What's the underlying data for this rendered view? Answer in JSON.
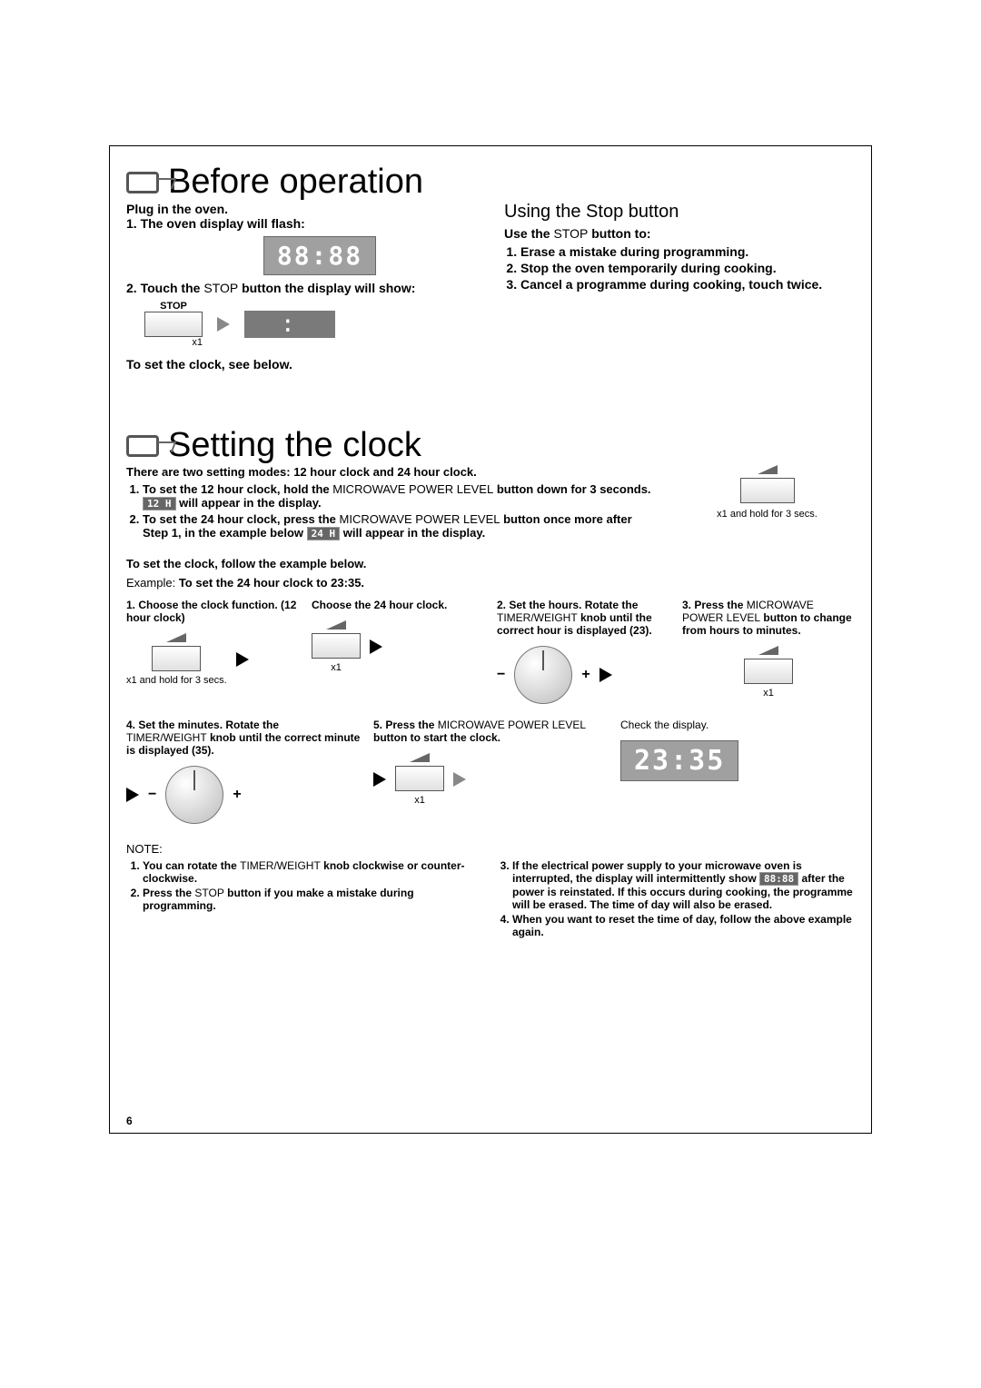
{
  "page_number": "6",
  "section1": {
    "title": "Before operation",
    "plug_in": "Plug in the oven.",
    "step1_prefix": "1. ",
    "step1": "The oven display will flash:",
    "display_flash": "88:88",
    "step2_prefix": "2. ",
    "step2a": "Touch the ",
    "step2_btn": "STOP",
    "step2b": " button the display will show:",
    "stop_label": "STOP",
    "stop_times": "x1",
    "colon": ":",
    "set_clock_note": "To set the clock, see below.",
    "rightcol_title": "Using the Stop button",
    "rightcol_lead_a": "Use the ",
    "rightcol_lead_btn": "STOP",
    "rightcol_lead_b": " button to:",
    "rightcol_items": [
      "Erase a mistake during programming.",
      "Stop the oven temporarily during cooking.",
      "Cancel a programme during cooking, touch twice."
    ]
  },
  "section2": {
    "title": "Setting the clock",
    "intro_modes": "There are two setting modes: 12 hour clock and 24 hour clock.",
    "mode1_a": "To set the 12 hour clock, hold the ",
    "mode_btn": "MICROWAVE POWER LEVEL",
    "mode1_b": " button down for 3 seconds. ",
    "mode1_chip": "12 H",
    "mode1_c": " will appear in the display.",
    "mode2_a": "To set the 24 hour clock, press the ",
    "mode2_b": " button once more after Step 1, in the example below ",
    "mode2_chip": "24 H",
    "mode2_c": " will appear in the display.",
    "right_hint": "x1 and hold for 3 secs.",
    "follow_example": "To set the clock, follow the example below.",
    "example_label": "Example:",
    "example_text": "To set the 24 hour clock to 23:35.",
    "steps_top": [
      {
        "num": "1.",
        "title": "Choose the clock function. (12 hour clock)",
        "caption": "x1 and hold for 3 secs."
      },
      {
        "num": "",
        "title": "Choose the 24 hour clock.",
        "caption": "x1"
      },
      {
        "num": "2.",
        "title_a": "Set the hours.",
        "title_b": "Rotate the ",
        "title_normal": "TIMER/WEIGHT",
        "title_c": " knob until the correct hour is displayed (23)."
      },
      {
        "num": "3.",
        "title_a": "Press the ",
        "title_normal": "MICROWAVE POWER LEVEL",
        "title_b": " button to change from hours to minutes.",
        "caption": "x1"
      }
    ],
    "steps_bottom": [
      {
        "num": "4.",
        "title_a": "Set the minutes. Rotate the ",
        "title_normal": "TIMER/WEIGHT",
        "title_b": " knob until the correct minute is displayed (35)."
      },
      {
        "num": "5.",
        "title_a": "Press the ",
        "title_normal": "MICROWAVE POWER LEVEL",
        "title_b": " button to start the clock.",
        "caption": "x1"
      },
      {
        "num": "",
        "title": "Check the display.",
        "result": "23:35"
      }
    ],
    "note_label": "NOTE:",
    "notes": [
      {
        "a": "You can rotate the ",
        "normal": "TIMER/WEIGHT",
        "b": " knob clockwise or counter-clockwise."
      },
      {
        "a": "Press the ",
        "normal": "STOP",
        "b": " button if you make a mistake during programming."
      },
      {
        "a": "If the electrical power supply to your microwave oven is interrupted, the display will intermittently show ",
        "chip": "88:88",
        "b": " after the power is reinstated. If this occurs during cooking, the programme will be erased. The time of day will also be erased."
      },
      {
        "a": "When you want to reset the time of day, follow the above example again."
      }
    ]
  }
}
